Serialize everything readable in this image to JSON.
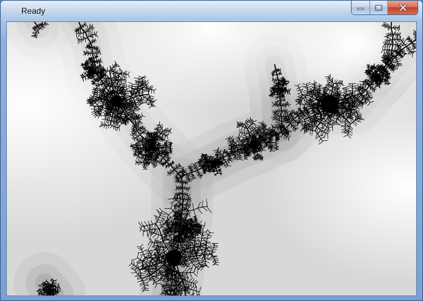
{
  "window": {
    "title": "Ready"
  },
  "caption_buttons": {
    "minimize_icon": "minimize-icon",
    "maximize_icon": "maximize-icon",
    "close_icon": "close-icon"
  },
  "canvas": {
    "content": "fractal-image",
    "colors": {
      "set": "#000000",
      "background_light": "#ffffff",
      "background_dark": "#cfcfcf"
    }
  }
}
